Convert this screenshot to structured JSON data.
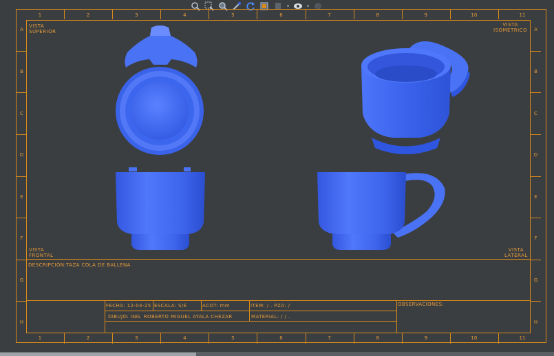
{
  "zones_columns": [
    "1",
    "2",
    "3",
    "4",
    "5",
    "6",
    "7",
    "8",
    "9",
    "10",
    "11"
  ],
  "zones_rows": [
    "A",
    "B",
    "C",
    "D",
    "E",
    "F",
    "G",
    "H"
  ],
  "views": {
    "top": "VISTA\nSUPERIOR",
    "iso": "VISTA\nISOMETRICO",
    "front": "VISTA\nFRONTAL",
    "side": "VISTA\nLATERAL"
  },
  "title_block": {
    "descripcion": "DESCRIPCIÓN:TAZA COLA DE BALLENA",
    "fecha": "FECHA: 12-04-25",
    "escala": "ESCALA: S/E",
    "acot": "ACOT: mm",
    "item": "ITEM: / . PZA: /",
    "dibujo": "DIBUJO: ING. ROBERTO MIGUEL AYALA CHEZAR",
    "material": "MATERIAL: / / .",
    "observaciones": "OBSERVACIONES:"
  },
  "toolbar": {
    "items": [
      "zoom-fit-icon",
      "zoom-area-icon",
      "zoom-in-icon",
      "pan-icon",
      "rotate-icon",
      "view-orient-icon",
      "display-style-icon",
      "hide-show-icon",
      "appearance-icon"
    ]
  },
  "colors": {
    "background": "#3b3e40",
    "frame": "#d98a1a",
    "text": "#e69b3a",
    "cup": "#3f68f0"
  }
}
